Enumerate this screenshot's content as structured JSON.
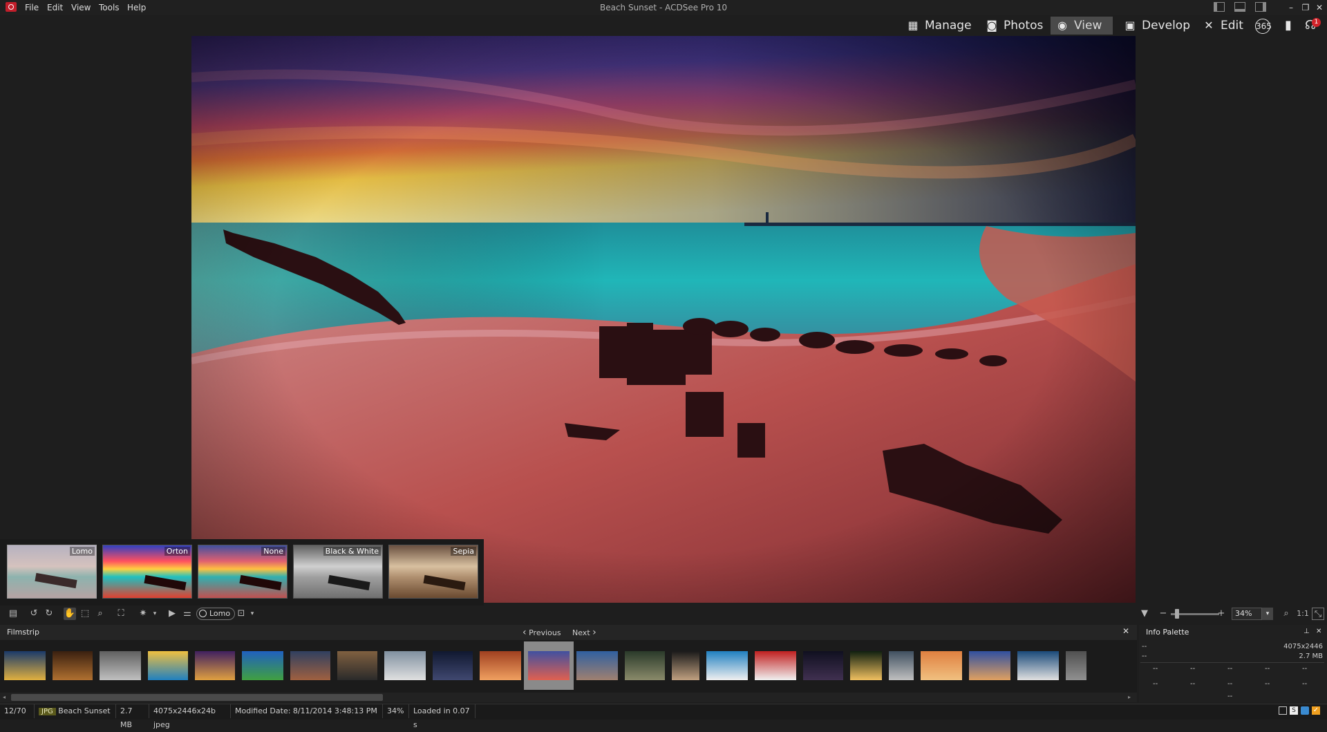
{
  "window": {
    "title": "Beach Sunset - ACDSee Pro 10",
    "minimize": "–",
    "restore": "❐",
    "close": "✕"
  },
  "menu": [
    "File",
    "Edit",
    "View",
    "Tools",
    "Help"
  ],
  "modes": [
    {
      "label": "Manage",
      "icon": "grid-icon"
    },
    {
      "label": "Photos",
      "icon": "camera-icon"
    },
    {
      "label": "View",
      "icon": "eye-icon",
      "active": true
    },
    {
      "label": "Develop",
      "icon": "develop-icon"
    },
    {
      "label": "Edit",
      "icon": "edit-tools-icon"
    }
  ],
  "extra_icons": [
    "365-icon",
    "dashboard-chart-icon",
    "notifications-icon"
  ],
  "notification_count": "1",
  "presets": [
    {
      "label": "Lomo"
    },
    {
      "label": "Orton"
    },
    {
      "label": "None"
    },
    {
      "label": "Black & White"
    },
    {
      "label": "Sepia"
    }
  ],
  "toolbar": {
    "effect_chip": "Lomo",
    "zoom_value": "34%",
    "zoom_1to1": "1:1"
  },
  "filmstrip": {
    "title": "Filmstrip",
    "previous": "Previous",
    "next": "Next",
    "selected_index": 11,
    "count": 24
  },
  "info_palette": {
    "title": "Info Palette",
    "row1_left": "--",
    "row1_right": "4075x2446",
    "row2_left": "--",
    "row2_right": "2.7 MB",
    "grid": [
      "--",
      "--",
      "--",
      "--",
      "--",
      "--",
      "--",
      "--",
      "--",
      "--"
    ],
    "bottom": "--"
  },
  "status": {
    "position": "12/70",
    "type": "JPG",
    "name": "Beach Sunset",
    "size": "2.7 MB",
    "dims": "4075x2446x24b jpeg",
    "modified": "Modified Date: 8/11/2014 3:48:13 PM",
    "zoom": "34%",
    "loaded": "Loaded in 0.07 s"
  }
}
